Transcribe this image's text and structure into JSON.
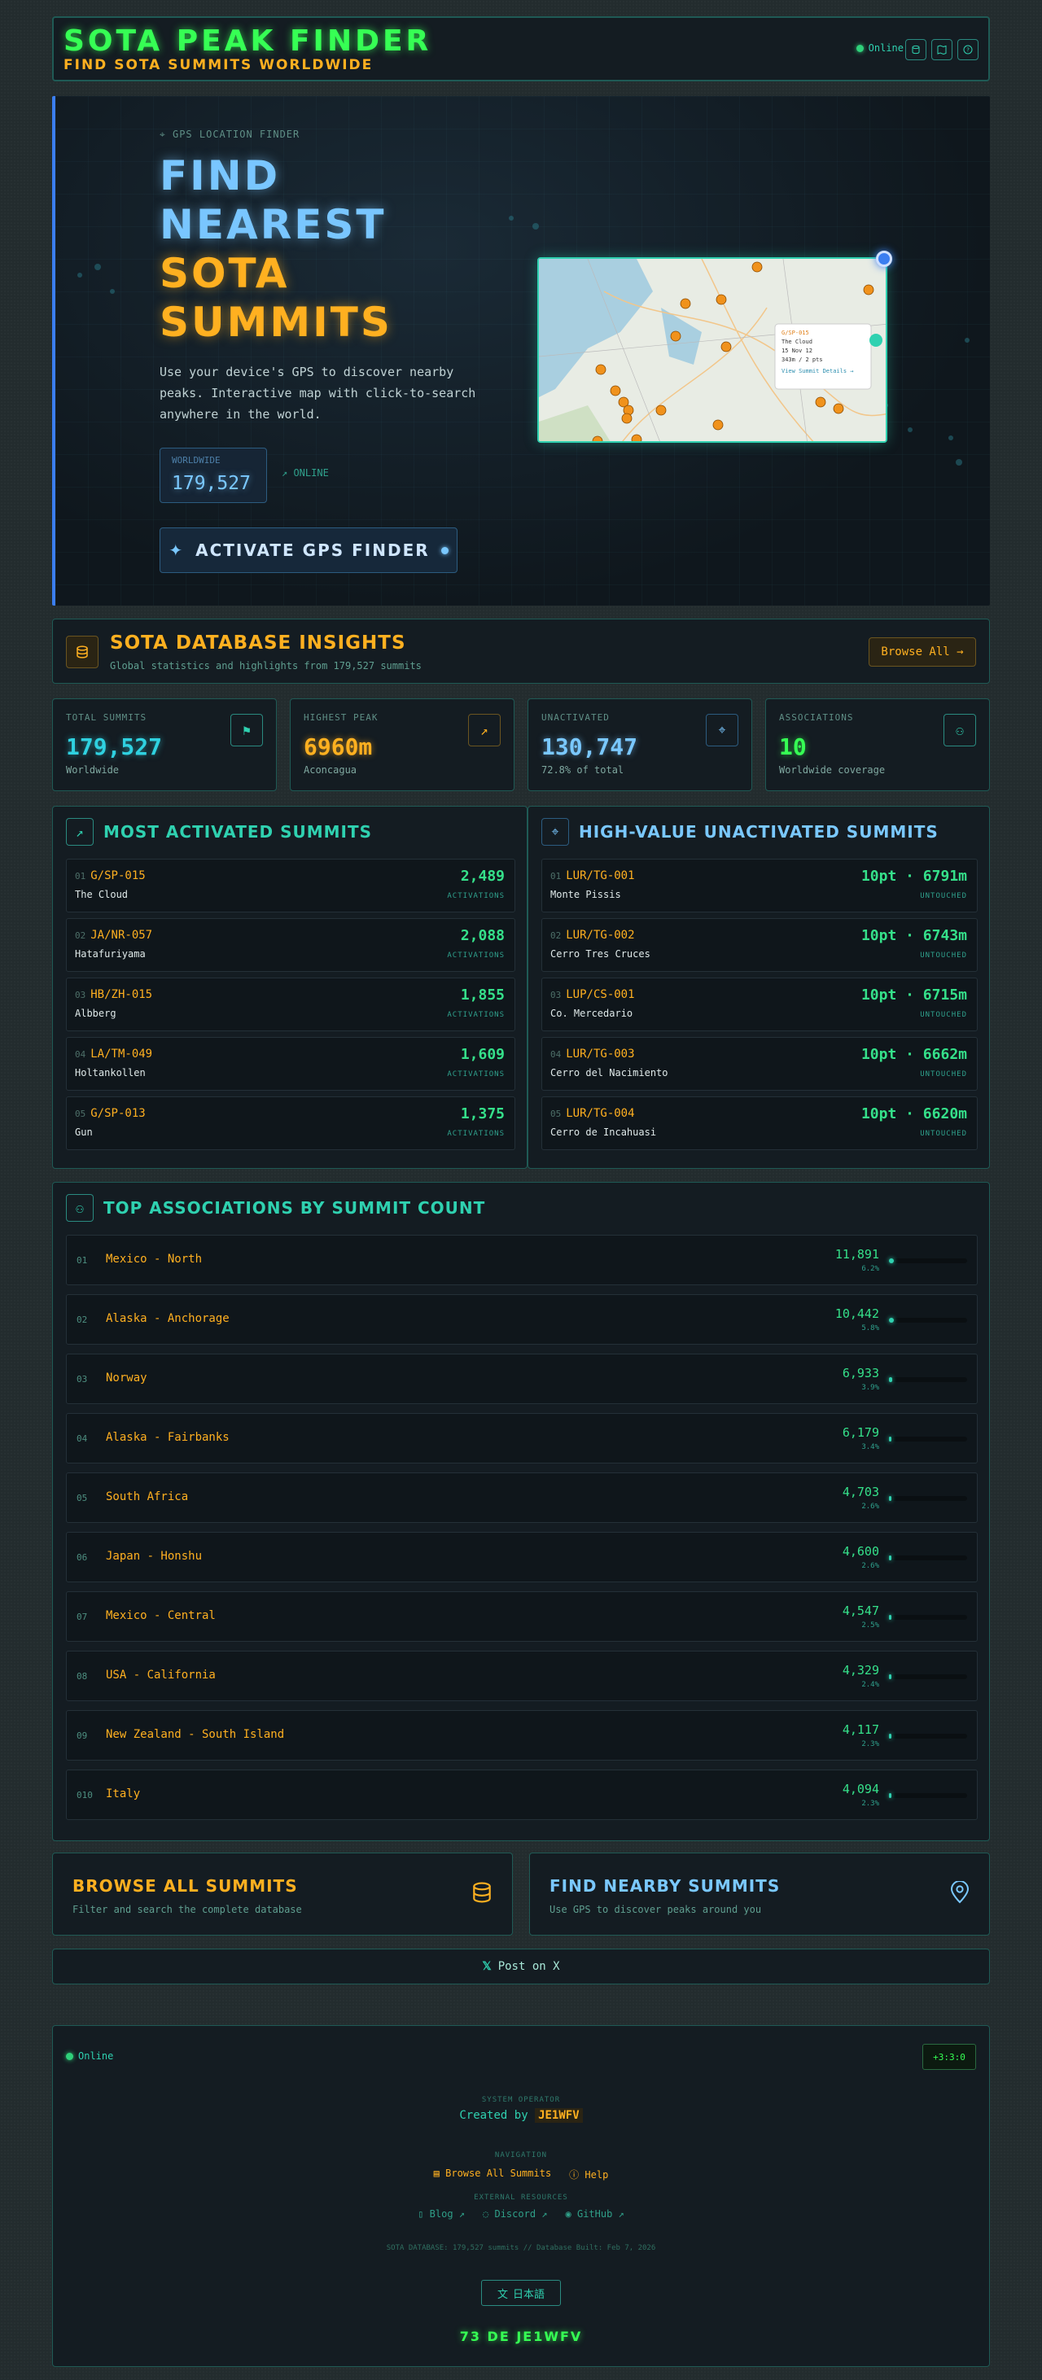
{
  "header": {
    "title": "SOTA PEAK FINDER",
    "subtitle": "FIND SOTA SUMMITS WORLDWIDE",
    "status": "Online",
    "buttons": [
      {
        "icon": "database-icon"
      },
      {
        "icon": "map-icon"
      },
      {
        "icon": "help-icon"
      }
    ]
  },
  "hero": {
    "kicker": "GPS LOCATION FINDER",
    "title_lines": [
      "FIND",
      "NEAREST",
      "SOTA",
      "SUMMITS"
    ],
    "title_colors": [
      "#79c6ff",
      "#79c6ff",
      "#ffb020",
      "#ffb020"
    ],
    "description": "Use your device's GPS to discover nearby peaks. Interactive map with click-to-search anywhere in the world.",
    "stat_label": "WORLDWIDE",
    "stat_value": "179,527",
    "online_label": "ONLINE",
    "cta_label": "ACTIVATE GPS FINDER",
    "map_popup": {
      "code": "G/SP-015",
      "name": "The Cloud",
      "line1": "15 Nov 12",
      "line2": "343m / 2 pts",
      "link": "View Summit Details →"
    }
  },
  "insights": {
    "title": "SOTA DATABASE INSIGHTS",
    "subtitle": "Global statistics and highlights from 179,527 summits",
    "button": "Browse All →"
  },
  "stats": [
    {
      "label": "TOTAL SUMMITS",
      "value": "179,527",
      "sub": "Worldwide",
      "color": "#2fd1e0",
      "icon": "flag-icon"
    },
    {
      "label": "HIGHEST PEAK",
      "value": "6960m",
      "sub": "Aconcagua",
      "color": "#ffb020",
      "icon": "trending-up-icon"
    },
    {
      "label": "UNACTIVATED",
      "value": "130,747",
      "sub": "72.8% of total",
      "color": "#7ac8ff",
      "icon": "map-pin-icon"
    },
    {
      "label": "ASSOCIATIONS",
      "value": "10",
      "sub": "Worldwide coverage",
      "color": "#36ff54",
      "icon": "users-icon"
    }
  ],
  "most_activated": {
    "title": "MOST ACTIVATED SUMMITS",
    "value_label": "ACTIVATIONS",
    "items": [
      {
        "n": "01",
        "code": "G/SP-015",
        "name": "The Cloud",
        "value": "2,489"
      },
      {
        "n": "02",
        "code": "JA/NR-057",
        "name": "Hatafuriyama",
        "value": "2,088"
      },
      {
        "n": "03",
        "code": "HB/ZH-015",
        "name": "Albberg",
        "value": "1,855"
      },
      {
        "n": "04",
        "code": "LA/TM-049",
        "name": "Holtankollen",
        "value": "1,609"
      },
      {
        "n": "05",
        "code": "G/SP-013",
        "name": "Gun",
        "value": "1,375"
      }
    ]
  },
  "unactivated": {
    "title": "HIGH-VALUE UNACTIVATED SUMMITS",
    "value_label": "UNTOUCHED",
    "items": [
      {
        "n": "01",
        "code": "LUR/TG-001",
        "name": "Monte Pissis",
        "value": "10pt · 6791m"
      },
      {
        "n": "02",
        "code": "LUR/TG-002",
        "name": "Cerro Tres Cruces",
        "value": "10pt · 6743m"
      },
      {
        "n": "03",
        "code": "LUP/CS-001",
        "name": "Co. Mercedario",
        "value": "10pt · 6715m"
      },
      {
        "n": "04",
        "code": "LUR/TG-003",
        "name": "Cerro del Nacimiento",
        "value": "10pt · 6662m"
      },
      {
        "n": "05",
        "code": "LUR/TG-004",
        "name": "Cerro de Incahuasi",
        "value": "10pt · 6620m"
      }
    ]
  },
  "associations": {
    "title": "TOP ASSOCIATIONS BY SUMMIT COUNT",
    "items": [
      {
        "n": "01",
        "name": "Mexico - North",
        "value": "11,891",
        "pct": "6.2%",
        "fill": 0.062
      },
      {
        "n": "02",
        "name": "Alaska - Anchorage",
        "value": "10,442",
        "pct": "5.8%",
        "fill": 0.058
      },
      {
        "n": "03",
        "name": "Norway",
        "value": "6,933",
        "pct": "3.9%",
        "fill": 0.039
      },
      {
        "n": "04",
        "name": "Alaska - Fairbanks",
        "value": "6,179",
        "pct": "3.4%",
        "fill": 0.034
      },
      {
        "n": "05",
        "name": "South Africa",
        "value": "4,703",
        "pct": "2.6%",
        "fill": 0.026
      },
      {
        "n": "06",
        "name": "Japan - Honshu",
        "value": "4,600",
        "pct": "2.6%",
        "fill": 0.026
      },
      {
        "n": "07",
        "name": "Mexico - Central",
        "value": "4,547",
        "pct": "2.5%",
        "fill": 0.025
      },
      {
        "n": "08",
        "name": "USA - California",
        "value": "4,329",
        "pct": "2.4%",
        "fill": 0.024
      },
      {
        "n": "09",
        "name": "New Zealand - South Island",
        "value": "4,117",
        "pct": "2.3%",
        "fill": 0.023
      },
      {
        "n": "010",
        "name": "Italy",
        "value": "4,094",
        "pct": "2.3%",
        "fill": 0.023
      }
    ]
  },
  "browse_card": {
    "title": "BROWSE ALL SUMMITS",
    "subtitle": "Filter and search the complete database"
  },
  "nearby_card": {
    "title": "FIND NEARBY SUMMITS",
    "subtitle": "Use GPS to discover peaks around you"
  },
  "share": {
    "label": "Post on X"
  },
  "footer": {
    "status": "Online",
    "clock": "+3:3:0",
    "operator_label": "SYSTEM OPERATOR",
    "created_by": "Created by",
    "callsign": "JE1WFV",
    "nav_label": "NAVIGATION",
    "nav_links": [
      "Browse All Summits",
      "Help"
    ],
    "ext_label": "EXTERNAL RESOURCES",
    "ext_links": [
      "Blog",
      "Discord",
      "GitHub"
    ],
    "build_info": "SOTA DATABASE: 179,527 summits // Database Built: Feb 7, 2026",
    "language": "日本語",
    "sign_off": "73 DE JE1WFV"
  }
}
